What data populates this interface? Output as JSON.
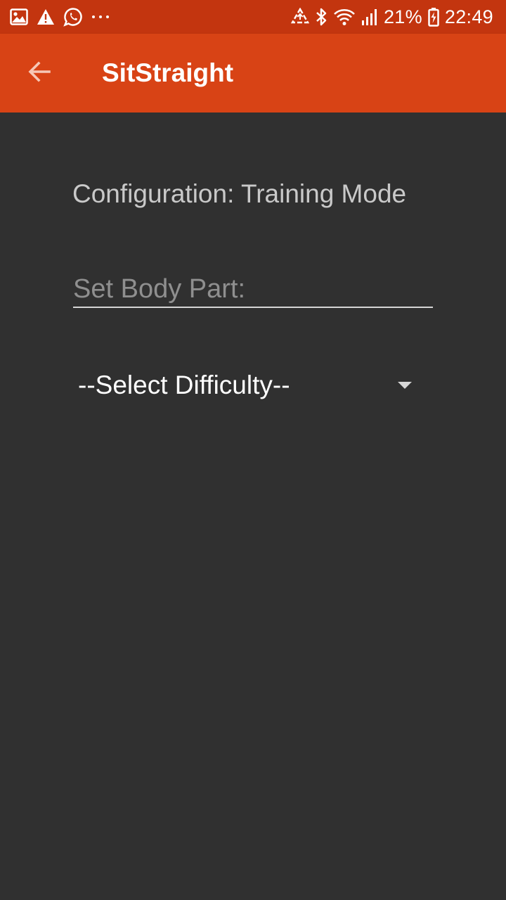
{
  "status_bar": {
    "left_icons": [
      "gallery-icon",
      "warning-icon",
      "whatsapp-icon",
      "more-notifications-icon"
    ],
    "right_icons": [
      "data-saver-icon",
      "bluetooth-icon",
      "wifi-icon",
      "signal-icon",
      "battery-icon"
    ],
    "battery_percent": "21%",
    "time": "22:49"
  },
  "app_bar": {
    "title": "SitStraight",
    "back_icon": "arrow-back-icon",
    "color": "#d84315"
  },
  "content": {
    "config_title": "Configuration: Training Mode",
    "body_part_input": {
      "placeholder": "Set Body Part:",
      "value": ""
    },
    "difficulty_select": {
      "selected": "--Select Difficulty--",
      "arrow_icon": "dropdown-arrow-icon"
    }
  },
  "colors": {
    "status_bar": "#c3350f",
    "app_bar": "#d84315",
    "background": "#303030"
  }
}
